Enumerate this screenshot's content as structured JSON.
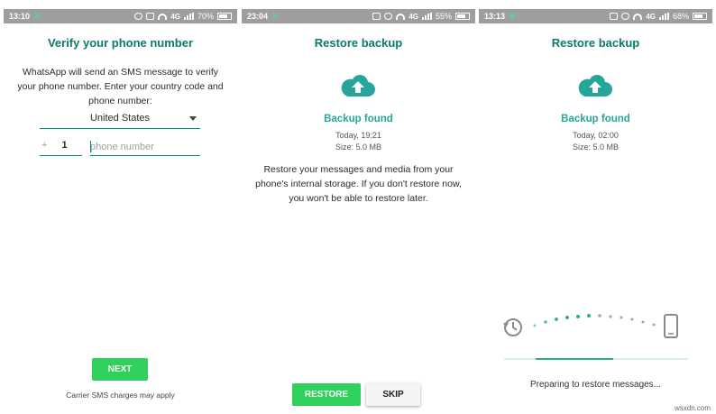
{
  "screens": [
    {
      "status": {
        "time": "13:10",
        "network": "4G",
        "battery": "70%"
      },
      "title": "Verify your phone number",
      "description": "WhatsApp will send an SMS message to verify your phone number. Enter your country code and phone number:",
      "country": "United States",
      "country_code_prefix": "+",
      "country_code": "1",
      "phone_placeholder": "phone number",
      "next_label": "NEXT",
      "charges_note": "Carrier SMS charges may apply"
    },
    {
      "status": {
        "time": "23:04",
        "network": "4G",
        "battery": "55%"
      },
      "title": "Restore backup",
      "backup_found": "Backup found",
      "backup_date": "Today, 19:21",
      "backup_size": "Size: 5.0 MB",
      "description": "Restore your messages and media from your phone's internal storage. If you don't restore now, you won't be able to restore later.",
      "restore_label": "RESTORE",
      "skip_label": "SKIP"
    },
    {
      "status": {
        "time": "13:13",
        "network": "4G",
        "battery": "68%"
      },
      "title": "Restore backup",
      "backup_found": "Backup found",
      "backup_date": "Today, 02:00",
      "backup_size": "Size: 5.0 MB",
      "progress": 0.42,
      "preparing": "Preparing to restore messages..."
    }
  ],
  "watermark": "wsxdn.com",
  "colors": {
    "title": "#0b7b6c",
    "accent": "#26a69a",
    "button_green": "#2fd05b",
    "status_bar": "#9e9e9e"
  },
  "icons": [
    "x-notification-icon",
    "alarm-icon",
    "vibrate-icon",
    "wifi-icon",
    "signal-icon",
    "battery-icon",
    "cloud-upload-icon",
    "history-icon",
    "phone-icon",
    "dropdown-caret-icon"
  ]
}
